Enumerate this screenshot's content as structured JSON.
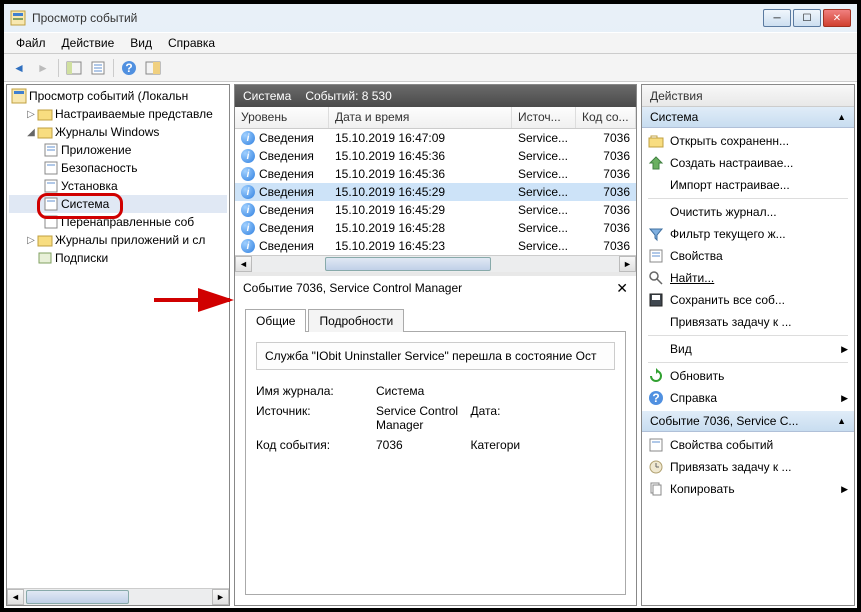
{
  "window": {
    "title": "Просмотр событий"
  },
  "menu": {
    "file": "Файл",
    "action": "Действие",
    "view": "Вид",
    "help": "Справка"
  },
  "tree": {
    "root": "Просмотр событий (Локальн",
    "custom": "Настраиваемые представле",
    "winlogs": "Журналы Windows",
    "app": "Приложение",
    "security": "Безопасность",
    "setup": "Установка",
    "system": "Система",
    "forwarded": "Перенаправленные соб",
    "applogs": "Журналы приложений и сл",
    "subs": "Подписки"
  },
  "events": {
    "header_title": "Система",
    "header_count": "Событий: 8 530",
    "cols": {
      "level": "Уровень",
      "datetime": "Дата и время",
      "source": "Источ...",
      "code": "Код со..."
    },
    "rows": [
      {
        "level": "Сведения",
        "dt": "15.10.2019 16:47:09",
        "src": "Service...",
        "code": "7036"
      },
      {
        "level": "Сведения",
        "dt": "15.10.2019 16:45:36",
        "src": "Service...",
        "code": "7036"
      },
      {
        "level": "Сведения",
        "dt": "15.10.2019 16:45:36",
        "src": "Service...",
        "code": "7036"
      },
      {
        "level": "Сведения",
        "dt": "15.10.2019 16:45:29",
        "src": "Service...",
        "code": "7036"
      },
      {
        "level": "Сведения",
        "dt": "15.10.2019 16:45:29",
        "src": "Service...",
        "code": "7036"
      },
      {
        "level": "Сведения",
        "dt": "15.10.2019 16:45:28",
        "src": "Service...",
        "code": "7036"
      },
      {
        "level": "Сведения",
        "dt": "15.10.2019 16:45:23",
        "src": "Service...",
        "code": "7036"
      }
    ]
  },
  "detail": {
    "title": "Событие 7036, Service Control Manager",
    "tab_general": "Общие",
    "tab_details": "Подробности",
    "message": "Служба \"IObit Uninstaller Service\" перешла в состояние Ост",
    "log_name_label": "Имя журнала:",
    "log_name": "Система",
    "source_label": "Источник:",
    "source": "Service Control Manager",
    "date_label": "Дата:",
    "eventid_label": "Код события:",
    "eventid": "7036",
    "category_label": "Категори"
  },
  "actions": {
    "header": "Действия",
    "section1": "Система",
    "open": "Открыть сохраненн...",
    "create": "Создать настраивае...",
    "import": "Импорт настраивае...",
    "clear": "Очистить журнал...",
    "filter": "Фильтр текущего ж...",
    "props": "Свойства",
    "find": "Найти...",
    "saveall": "Сохранить все соб...",
    "attach": "Привязать задачу к ...",
    "view": "Вид",
    "refresh": "Обновить",
    "help": "Справка",
    "section2": "Событие 7036, Service C...",
    "evprops": "Свойства событий",
    "evattach": "Привязать задачу к ...",
    "copy": "Копировать"
  },
  "icons": {
    "back": "◄",
    "fwd": "►",
    "up_arrow": "▲"
  }
}
